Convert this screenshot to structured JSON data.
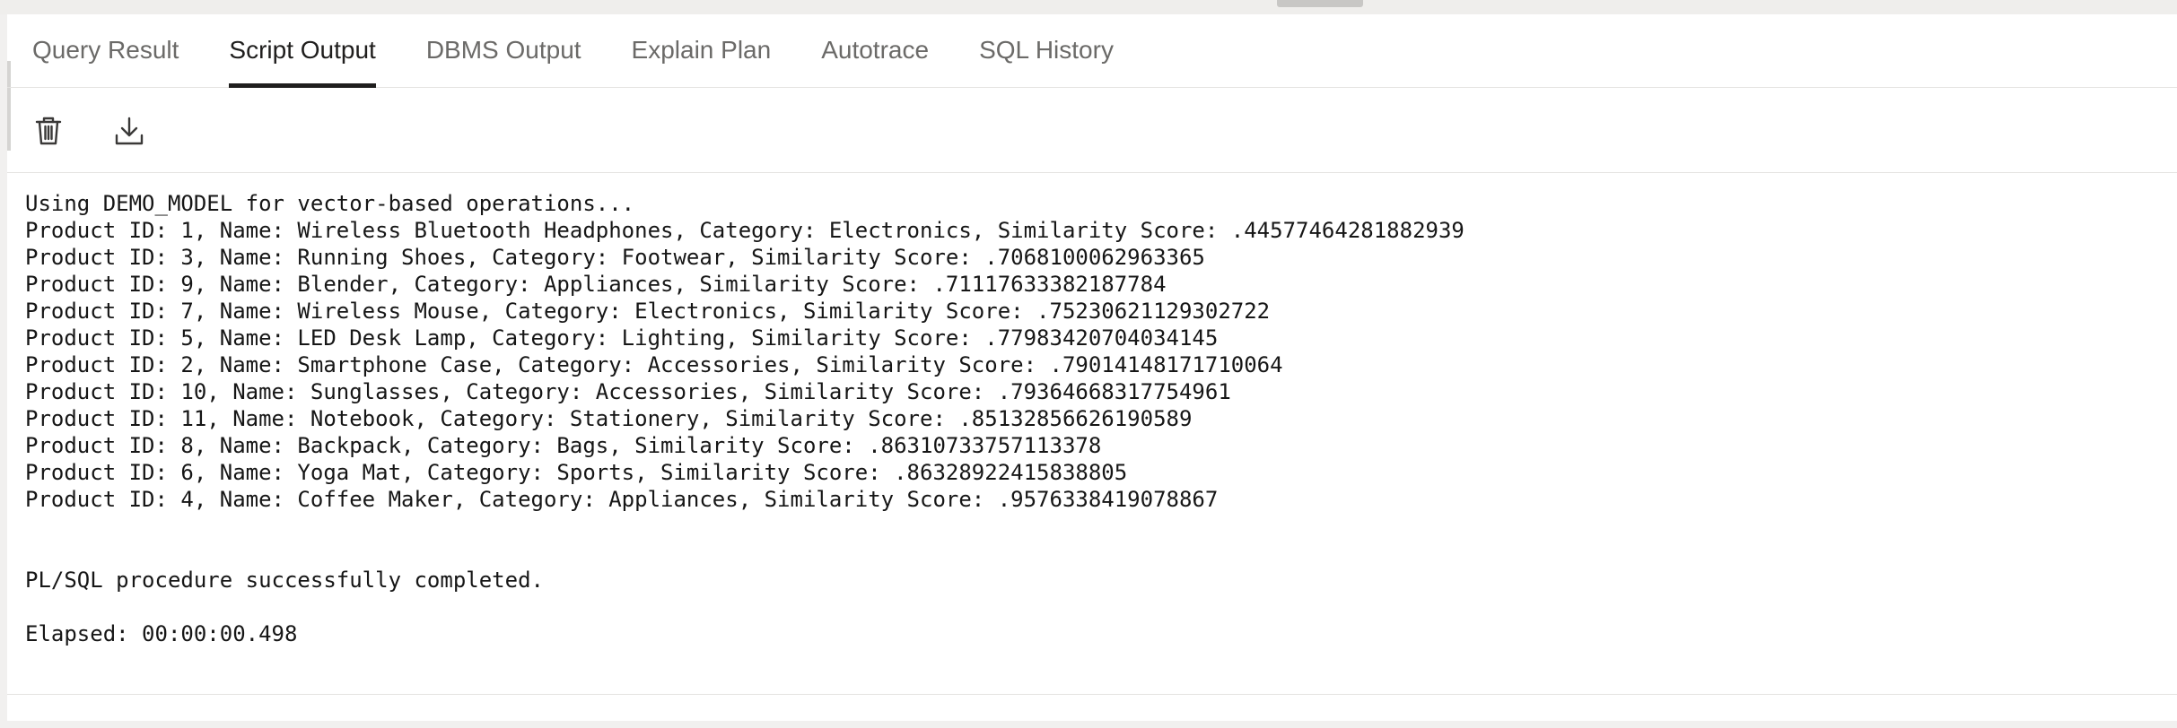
{
  "tabs": [
    {
      "label": "Query Result",
      "active": false
    },
    {
      "label": "Script Output",
      "active": true
    },
    {
      "label": "DBMS Output",
      "active": false
    },
    {
      "label": "Explain Plan",
      "active": false
    },
    {
      "label": "Autotrace",
      "active": false
    },
    {
      "label": "SQL History",
      "active": false
    }
  ],
  "toolbar": {
    "buttons": [
      {
        "icon": "trash-icon",
        "action": "clear"
      },
      {
        "icon": "download-icon",
        "action": "download"
      }
    ]
  },
  "output": {
    "lines": [
      "Using DEMO_MODEL for vector-based operations...",
      "Product ID: 1, Name: Wireless Bluetooth Headphones, Category: Electronics, Similarity Score: .44577464281882939",
      "Product ID: 3, Name: Running Shoes, Category: Footwear, Similarity Score: .7068100062963365",
      "Product ID: 9, Name: Blender, Category: Appliances, Similarity Score: .71117633382187784",
      "Product ID: 7, Name: Wireless Mouse, Category: Electronics, Similarity Score: .75230621129302722",
      "Product ID: 5, Name: LED Desk Lamp, Category: Lighting, Similarity Score: .77983420704034145",
      "Product ID: 2, Name: Smartphone Case, Category: Accessories, Similarity Score: .79014148171710064",
      "Product ID: 10, Name: Sunglasses, Category: Accessories, Similarity Score: .79364668317754961",
      "Product ID: 11, Name: Notebook, Category: Stationery, Similarity Score: .85132856626190589",
      "Product ID: 8, Name: Backpack, Category: Bags, Similarity Score: .86310733757113378",
      "Product ID: 6, Name: Yoga Mat, Category: Sports, Similarity Score: .86328922415838805",
      "Product ID: 4, Name: Coffee Maker, Category: Appliances, Similarity Score: .9576338419078867",
      "",
      "",
      "PL/SQL procedure successfully completed.",
      "",
      "Elapsed: 00:00:00.498"
    ]
  },
  "colors": {
    "active_tab": "#1f1e1d",
    "inactive_tab": "#6b6a68",
    "border": "#e4e3e1",
    "background": "#f1f0ef",
    "panel": "#ffffff"
  }
}
